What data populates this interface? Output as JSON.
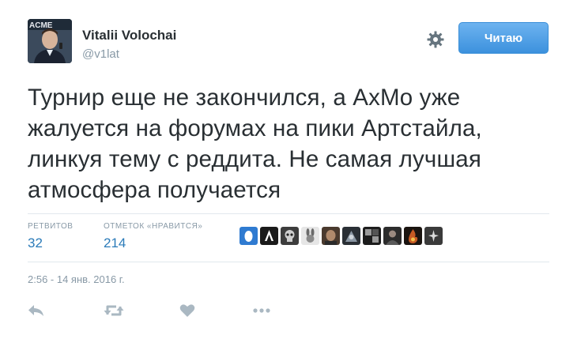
{
  "user": {
    "name": "Vitalii Volochai",
    "handle": "@v1lat"
  },
  "follow_button": {
    "label": "Читаю"
  },
  "tweet": {
    "lines": [
      "Турнир еще не закончился, а AxMo уже",
      "жалуется на форумах на пики Артстайла,",
      "линкуя тему с реддита. Не самая лучшая",
      "атмосфера получается"
    ]
  },
  "stats": {
    "retweets": {
      "label": "РЕТВИТОВ",
      "value": "32"
    },
    "likes": {
      "label": "ОТМЕТОК «НРАВИТСЯ»",
      "value": "214"
    }
  },
  "likers": [
    "egg-avatar",
    "a-logo-avatar",
    "skull-avatar",
    "bunny-avatar",
    "face-avatar",
    "warrior-avatar",
    "chess-avatar",
    "portrait-avatar",
    "fire-avatar",
    "dark-figure-avatar"
  ],
  "timestamp": "2:56 - 14 янв. 2016 г.",
  "icons": {
    "reply": "reply-icon",
    "retweet": "retweet-icon",
    "like": "heart-icon",
    "more": "more-icon",
    "settings": "gear-icon"
  },
  "colors": {
    "follow_button": "#4a9ee6",
    "stat_value": "#2b7bb9",
    "muted": "#8899a6",
    "text": "#292f33",
    "action_icon": "#aab8c2"
  }
}
